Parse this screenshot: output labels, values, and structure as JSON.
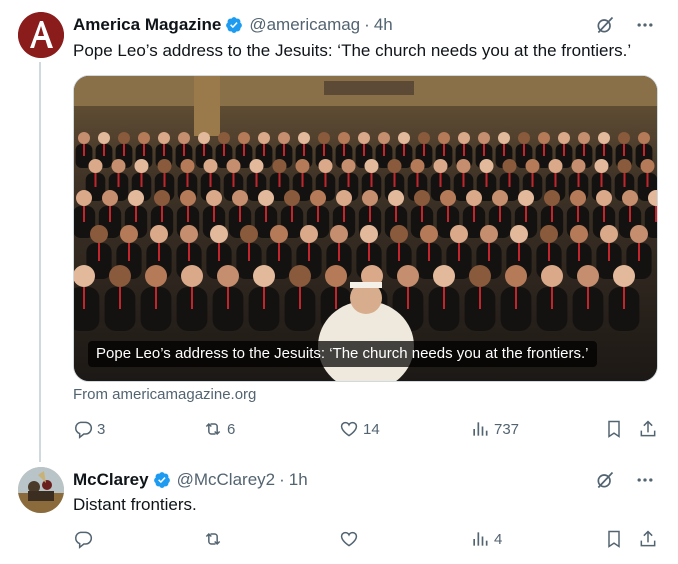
{
  "tweet1": {
    "name": "America Magazine",
    "handle": "@americamag",
    "separator": "·",
    "time": "4h",
    "text": "Pope Leo’s address to the Jesuits: ‘The church needs you at the frontiers.’",
    "media_caption": "Pope Leo’s address to the Jesuits: ‘The church needs you at the frontiers.’",
    "source": "From americamagazine.org",
    "stats": {
      "replies": "3",
      "reposts": "6",
      "likes": "14",
      "views": "737"
    }
  },
  "tweet2": {
    "name": "McClarey",
    "handle": "@McClarey2",
    "separator": "·",
    "time": "1h",
    "text": "Distant frontiers.",
    "stats": {
      "replies": "",
      "reposts": "",
      "likes": "",
      "views": "4"
    }
  },
  "colors": {
    "text": "#0f1419",
    "secondary": "#536471",
    "verified": "#1d9bf0",
    "border": "#cfd9de",
    "avatar_brand": "#8a1c1c"
  },
  "icons": [
    "grok-icon",
    "more-icon",
    "verified-icon",
    "reply-icon",
    "repost-icon",
    "like-icon",
    "views-icon",
    "bookmark-icon",
    "share-icon"
  ]
}
